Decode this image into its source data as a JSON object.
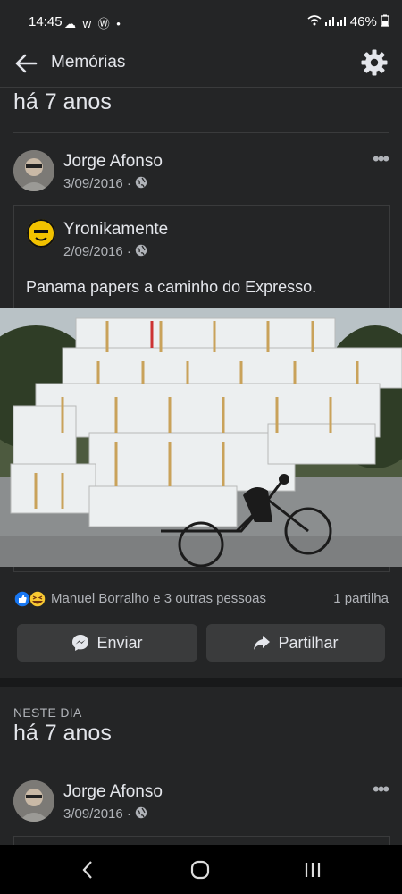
{
  "status_bar": {
    "time": "14:45",
    "notification_icons": "☁ w Ⓦ •",
    "signal_text": "46%"
  },
  "header": {
    "title": "Memórias"
  },
  "memory1": {
    "years_ago": "há 7 anos",
    "author": "Jorge Afonso",
    "date": "3/09/2016 ·",
    "shared": {
      "author": "Yronikamente",
      "date": "2/09/2016 ·",
      "text": "Panama papers a caminho do Expresso."
    },
    "reactions_text": "Manuel Borralho e 3 outras pessoas",
    "shares_text": "1 partilha",
    "send_label": "Enviar",
    "share_label": "Partilhar"
  },
  "memory2": {
    "section_label": "NESTE DIA",
    "years_ago": "há 7 anos",
    "author": "Jorge Afonso",
    "date": "3/09/2016 ·"
  },
  "colors": {
    "background": "#242526",
    "card": "#242526",
    "button": "#3a3b3c",
    "text": "#e4e6eb",
    "muted": "#b0b3b8",
    "like_blue": "#1877f2"
  },
  "icons": [
    "back-arrow-icon",
    "gear-icon",
    "globe-icon",
    "more-icon",
    "messenger-icon",
    "share-arrow-icon",
    "like-icon",
    "haha-icon",
    "nav-back-icon",
    "nav-home-icon",
    "nav-recents-icon"
  ]
}
